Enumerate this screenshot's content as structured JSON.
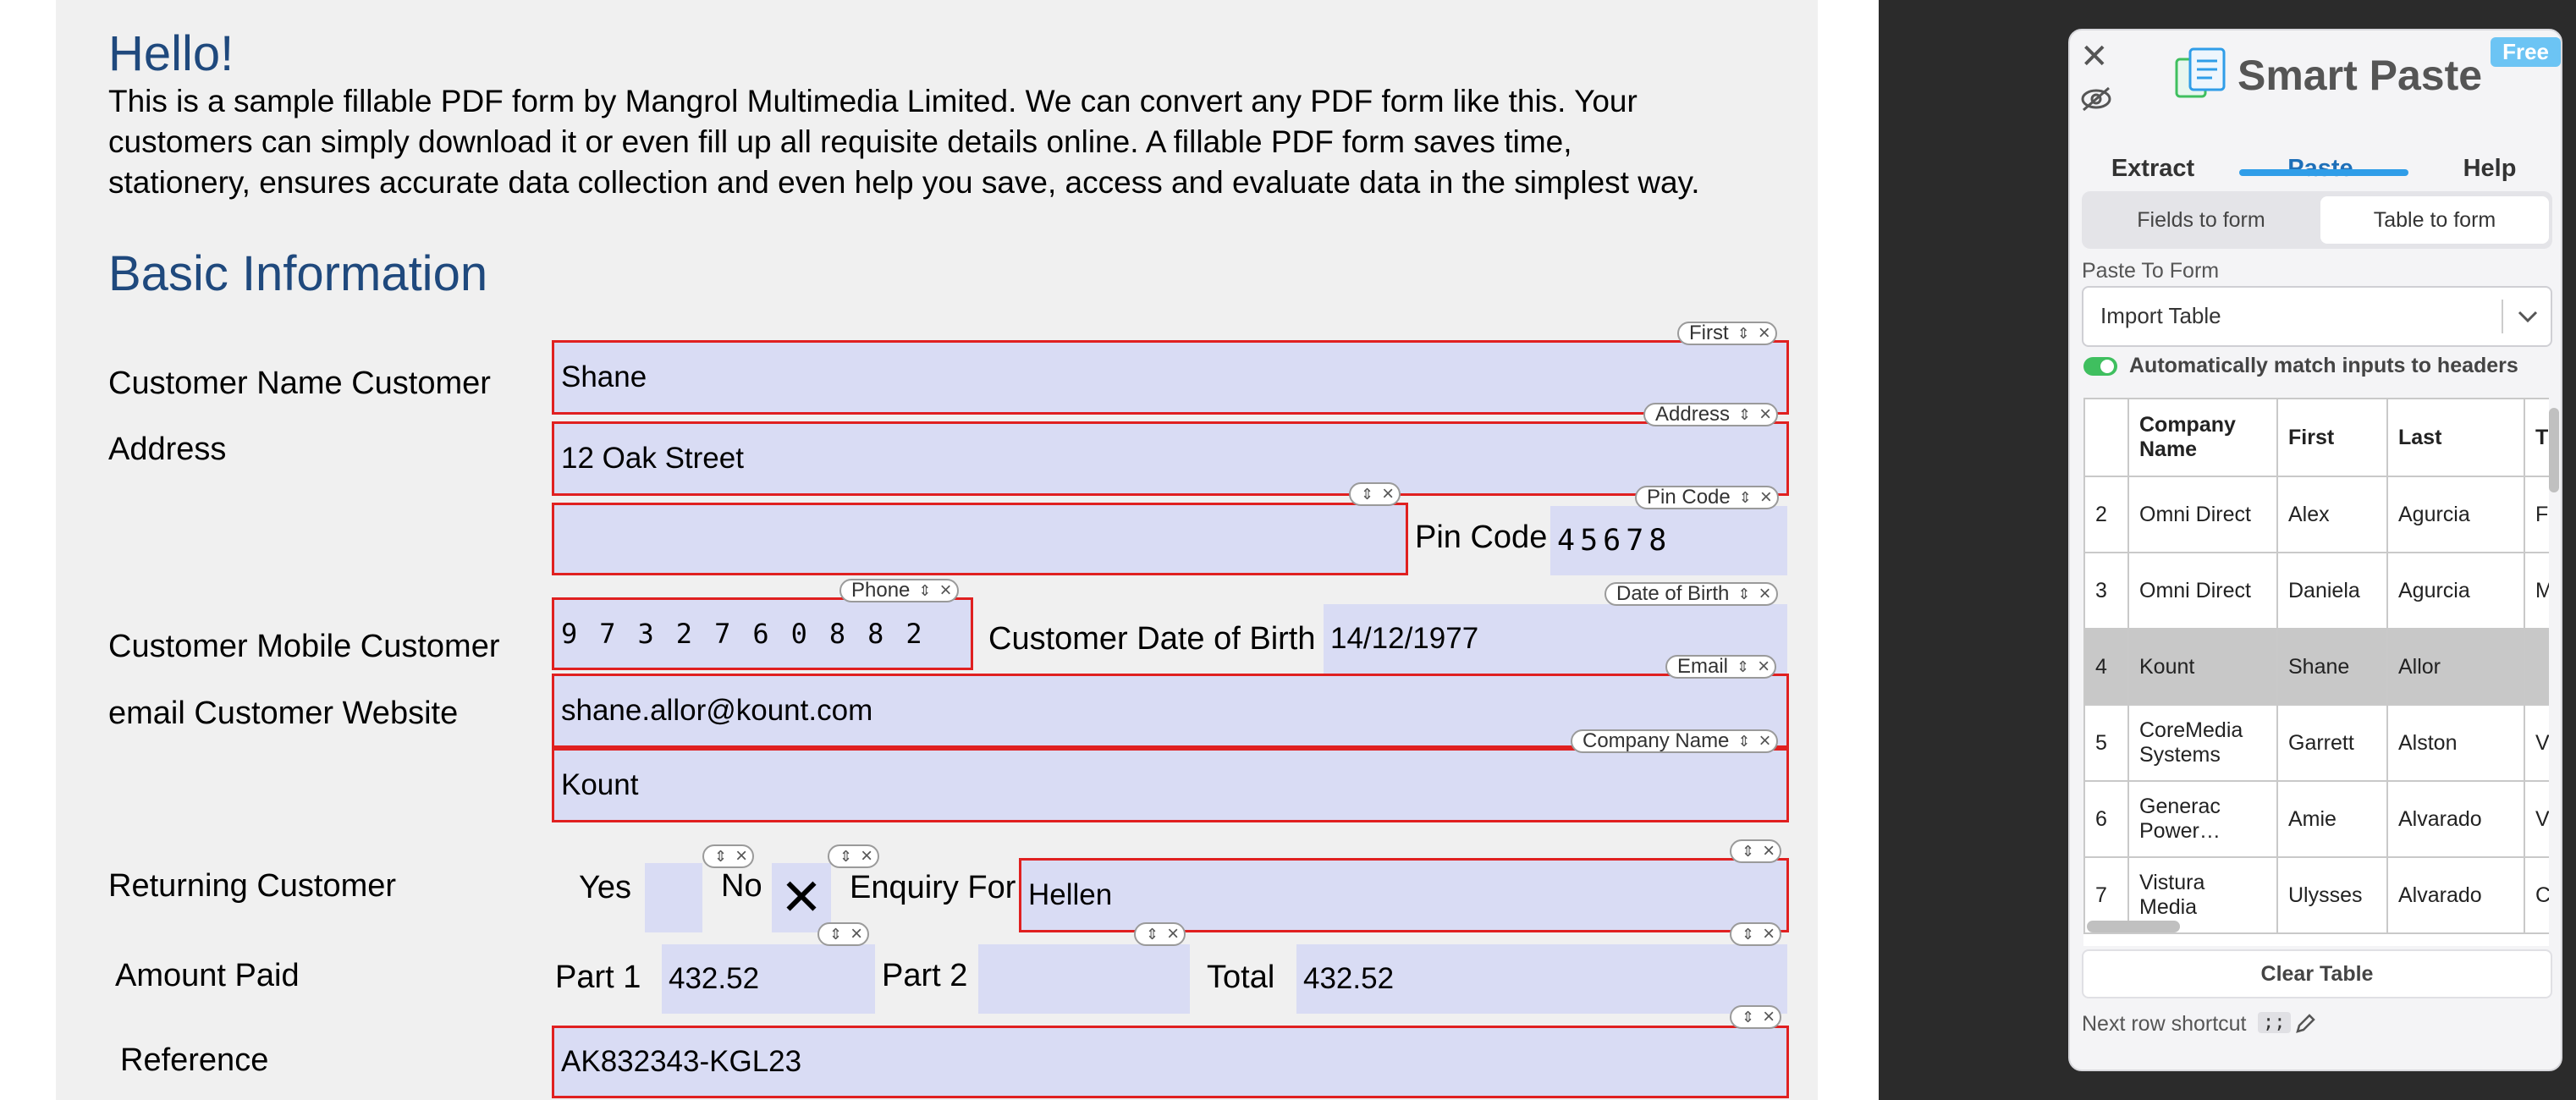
{
  "pdf": {
    "greeting": "Hello!",
    "intro_lines": [
      "This is a sample fillable PDF form by Mangrol Multimedia Limited. We can convert any PDF form like this. Your",
      "customers can simply download it or even fill up all requisite details online. A fillable PDF form saves time,",
      "stationery, ensures accurate data collection and even help you save, access and evaluate data in the simplest way."
    ],
    "section_title": "Basic Information",
    "labels": {
      "customer_name": "Customer Name Customer",
      "address": "Address",
      "pin_code": "Pin Code",
      "mobile": "Customer Mobile  Customer",
      "email_website": "email Customer Website",
      "date_of_birth": "Customer Date of Birth",
      "returning": "Returning Customer",
      "yes": "Yes",
      "no": "No",
      "enquiry_for": "Enquiry For",
      "amount_paid": "Amount Paid",
      "part1": "Part 1",
      "part2": "Part 2",
      "total": "Total",
      "reference": "Reference"
    },
    "fields": {
      "customer_name": "Shane",
      "address1": "12 Oak Street",
      "address2": "",
      "pin_code": "45678",
      "mobile": "9732760882",
      "date_of_birth": "14/12/1977",
      "email": "shane.allor@kount.com",
      "website": "Kount",
      "enquiry_for": "Hellen",
      "part1": "432.52",
      "part2": "",
      "total": "432.52",
      "reference": "AK832343-KGL23",
      "no_mark": "✕"
    },
    "tags": {
      "first": "First",
      "address": "Address",
      "pin_code": "Pin Code",
      "phone": "Phone",
      "date_of_birth": "Date of Birth",
      "email": "Email",
      "company_name": "Company Name"
    }
  },
  "panel": {
    "close_glyph": "✕",
    "title": "Smart Paste",
    "badge": "Free",
    "tabs": [
      "Extract",
      "Paste",
      "Help"
    ],
    "active_tab": "Paste",
    "segments": [
      "Fields to form",
      "Table to form"
    ],
    "active_segment": "Table to form",
    "paste_to_form_label": "Paste To Form",
    "paste_to_form_value": "Import Table",
    "auto_match_label": "Automatically match inputs to headers",
    "auto_match_on": true,
    "table": {
      "headers": [
        "",
        "Company Name",
        "First",
        "Last",
        "T"
      ],
      "rows": [
        [
          "2",
          "Omni Direct",
          "Alex",
          "Agurcia",
          "F"
        ],
        [
          "3",
          "Omni Direct",
          "Daniela",
          "Agurcia",
          "M A"
        ],
        [
          "4",
          "Kount",
          "Shane",
          "Allor",
          ""
        ],
        [
          "5",
          "CoreMedia Systems",
          "Garrett",
          "Alston",
          "V S"
        ],
        [
          "6",
          "Generac Power…",
          "Amie",
          "Alvarado",
          "V"
        ],
        [
          "7",
          "Vistura Media",
          "Ulysses",
          "Alvarado",
          "C"
        ]
      ],
      "highlighted_row": "4"
    },
    "clear_table_label": "Clear Table",
    "shortcut_label": "Next row shortcut",
    "shortcut_key": ";;"
  },
  "colors": {
    "heading": "#1f497d",
    "field_fill": "#d9dcf4",
    "field_border": "#e02020",
    "accent": "#2f9de8",
    "toggle_on": "#3fbf5f"
  }
}
